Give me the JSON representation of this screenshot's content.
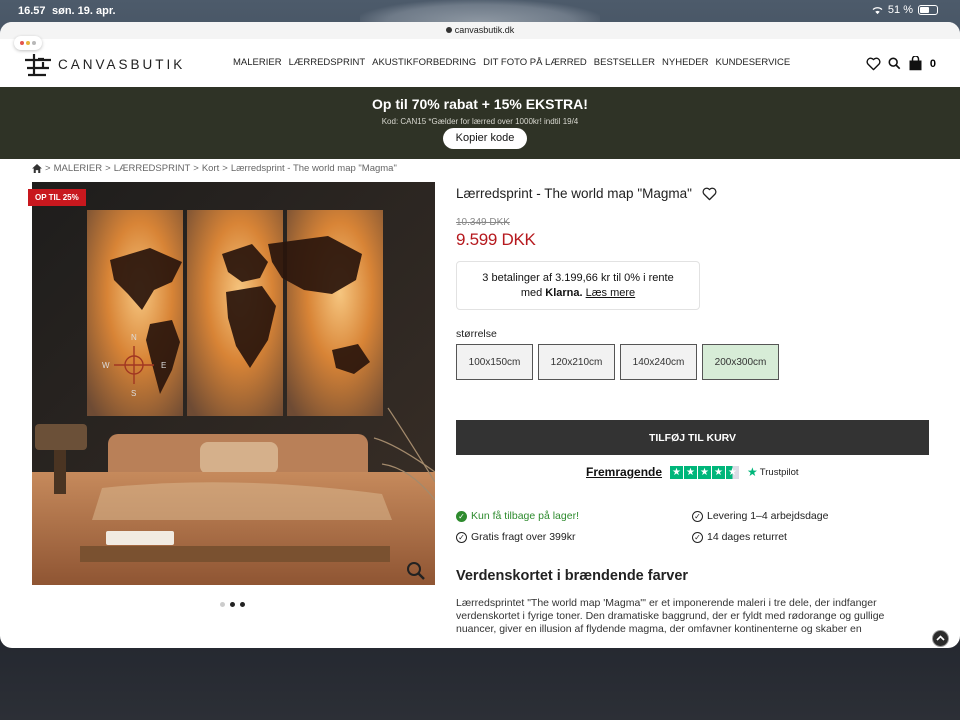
{
  "status_bar": {
    "time": "16.57",
    "date": "søn. 19. apr.",
    "battery": "51 %"
  },
  "browser": {
    "url": "canvasbutik.dk"
  },
  "header": {
    "logo_text": "CANVASBUTIK",
    "nav": [
      "MALERIER",
      "LÆRREDSPRINT",
      "AKUSTIKFORBEDRING",
      "DIT FOTO PÅ LÆRRED",
      "BESTSELLER",
      "NYHEDER",
      "KUNDESERVICE"
    ],
    "cart_count": "0"
  },
  "promo": {
    "title": "Op til 70% rabat + 15% EKSTRA!",
    "subtitle": "Kod: CAN15 *Gælder for lærred over 1000kr! indtil 19/4",
    "copy_button": "Kopier kode"
  },
  "breadcrumb": [
    "MALERIER",
    "LÆRREDSPRINT",
    "Kort",
    "Lærredsprint - The world map \"Magma\""
  ],
  "gallery": {
    "badge": "OP TIL 25%",
    "dots": 3,
    "active_dot": 2
  },
  "product": {
    "title": "Lærredsprint - The world map \"Magma\"",
    "old_price": "10.349 DKK",
    "price": "9.599 DKK",
    "klarna": {
      "line1": "3 betalinger af 3.199,66 kr til 0% i rente",
      "med": "med",
      "brand": "Klarna.",
      "more": "Læs mere"
    },
    "size_label": "størrelse",
    "sizes": [
      "100x150cm",
      "120x210cm",
      "140x240cm",
      "200x300cm"
    ],
    "selected_size": "200x300cm",
    "add_to_cart": "TILFØJ TIL KURV"
  },
  "trustpilot": {
    "rating_label": "Fremragende",
    "brand": "Trustpilot",
    "stars": 4.5
  },
  "features": {
    "stock": "Kun få tilbage på lager!",
    "delivery": "Levering 1–4 arbejdsdage",
    "shipping": "Gratis fragt over 399kr",
    "returns": "14 dages returret"
  },
  "description": {
    "heading": "Verdenskortet i brændende farver",
    "text": "Lærredsprintet \"The world map 'Magma'\" er et imponerende maleri i tre dele, der indfanger verdenskortet i fyrige toner. Den dramatiske baggrund, der er fyldt med rødorange og gullige nuancer, giver en illusion af flydende magma, der omfavner kontinenterne og skaber en"
  },
  "colors": {
    "promo_bg": "#2f3326",
    "price_red": "#b6191e",
    "badge_red": "#c8181e",
    "cart_btn": "#333333",
    "selected_size_bg": "#d7ecd7",
    "trustpilot_green": "#00b67a",
    "stock_green": "#2e8b2e"
  }
}
